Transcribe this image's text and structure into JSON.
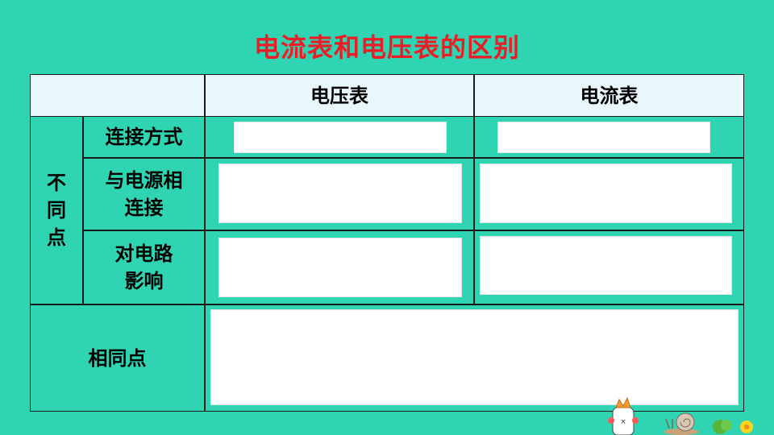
{
  "title": "电流表和电压表的区别",
  "table": {
    "col_headers": [
      "电压表",
      "电流表"
    ],
    "group_label": [
      "不",
      "同",
      "点"
    ],
    "rows": [
      {
        "label": "连接方式",
        "voltmeter": "",
        "ammeter": ""
      },
      {
        "label": [
          "与电源相",
          "连接"
        ],
        "voltmeter": "",
        "ammeter": ""
      },
      {
        "label": [
          "对电路",
          "影响"
        ],
        "voltmeter": "",
        "ammeter": ""
      }
    ],
    "same_label": "相同点",
    "same_value": ""
  },
  "colors": {
    "background": "#2fd4b2",
    "title": "#ee1c25",
    "header_fill": "#e8f7fb",
    "answer_box": "#ffffff"
  }
}
